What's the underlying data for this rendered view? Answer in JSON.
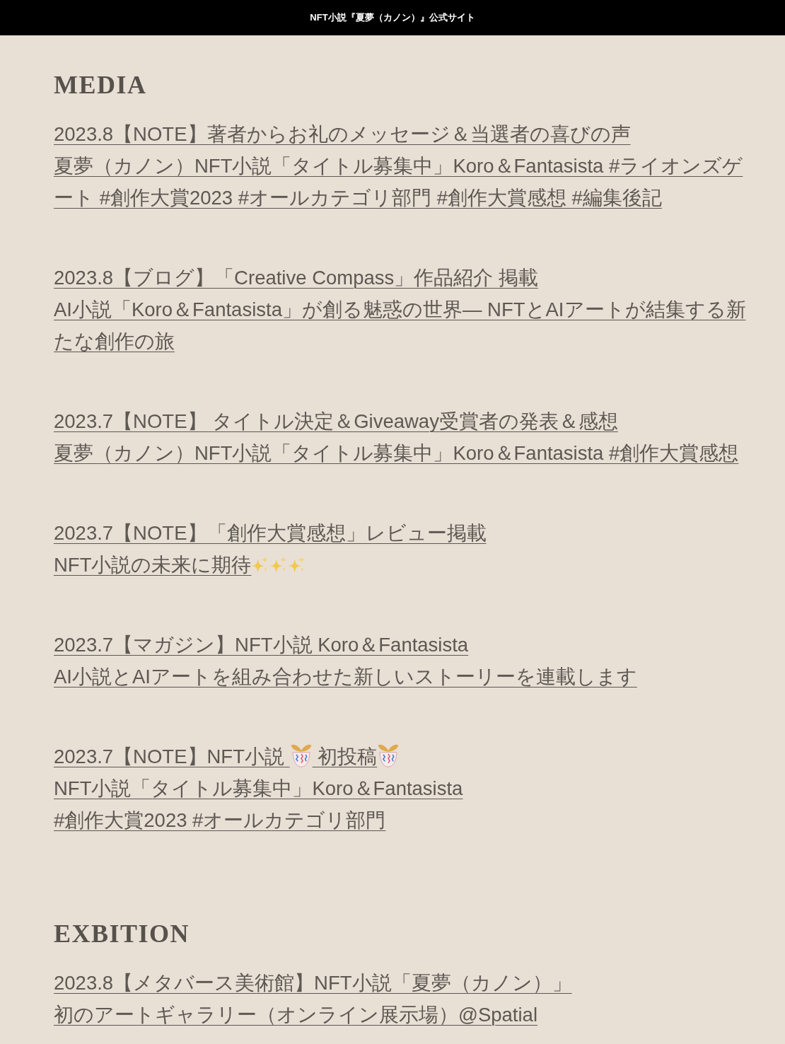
{
  "header": {
    "title": "NFT小説『夏夢（カノン）』公式サイト"
  },
  "sections": [
    {
      "heading": "MEDIA",
      "entries": [
        {
          "lines": [
            {
              "text": "2023.8【NOTE】著者からお礼のメッセージ＆当選者の喜びの声"
            },
            {
              "text": "夏夢（カノン）NFT小説「タイトル募集中」Koro＆Fantasista #ライオンズゲート #創作大賞2023 #オールカテゴリ部門 #創作大賞感想 #編集後記"
            }
          ]
        },
        {
          "lines": [
            {
              "text": "2023.8【ブログ】「Creative Compass」作品紹介 掲載"
            },
            {
              "text": "AI小説「Koro＆Fantasista」が創る魅惑の世界― NFTとAIアートが結集する新たな創作の旅"
            }
          ]
        },
        {
          "lines": [
            {
              "text": "2023.7【NOTE】 タイトル決定＆Giveaway受賞者の発表＆感想"
            },
            {
              "text": "夏夢（カノン）NFT小説「タイトル募集中」Koro＆Fantasista #創作大賞感想"
            }
          ]
        },
        {
          "lines": [
            {
              "text": "2023.7【NOTE】「創作大賞感想」レビュー掲載"
            },
            {
              "parts": [
                {
                  "kind": "text",
                  "text": "NFT小説の未来に期待"
                },
                {
                  "kind": "sparkles"
                },
                {
                  "kind": "sparkles"
                },
                {
                  "kind": "sparkles"
                }
              ]
            }
          ]
        },
        {
          "lines": [
            {
              "text": "2023.7【マガジン】NFT小説 Koro＆Fantasista"
            },
            {
              "text": "AI小説とAIアートを組み合わせた新しいストーリーを連載します"
            }
          ]
        },
        {
          "lines": [
            {
              "parts": [
                {
                  "kind": "text",
                  "text": "2023.7【NOTE】NFT小説 "
                },
                {
                  "kind": "confetti"
                },
                {
                  "kind": "text",
                  "text": " 初投稿"
                },
                {
                  "kind": "confetti"
                }
              ]
            },
            {
              "text": "NFT小説「タイトル募集中」Koro＆Fantasista"
            },
            {
              "text": "#創作大賞2023 #オールカテゴリ部門"
            }
          ]
        }
      ]
    },
    {
      "heading": "EXBITION",
      "entries": [
        {
          "lines": [
            {
              "text": "2023.8【メタバース美術館】NFT小説「夏夢（カノン）」"
            },
            {
              "text": "初のアートギャラリー（オンライン展示場）@Spatial"
            }
          ]
        }
      ]
    }
  ]
}
